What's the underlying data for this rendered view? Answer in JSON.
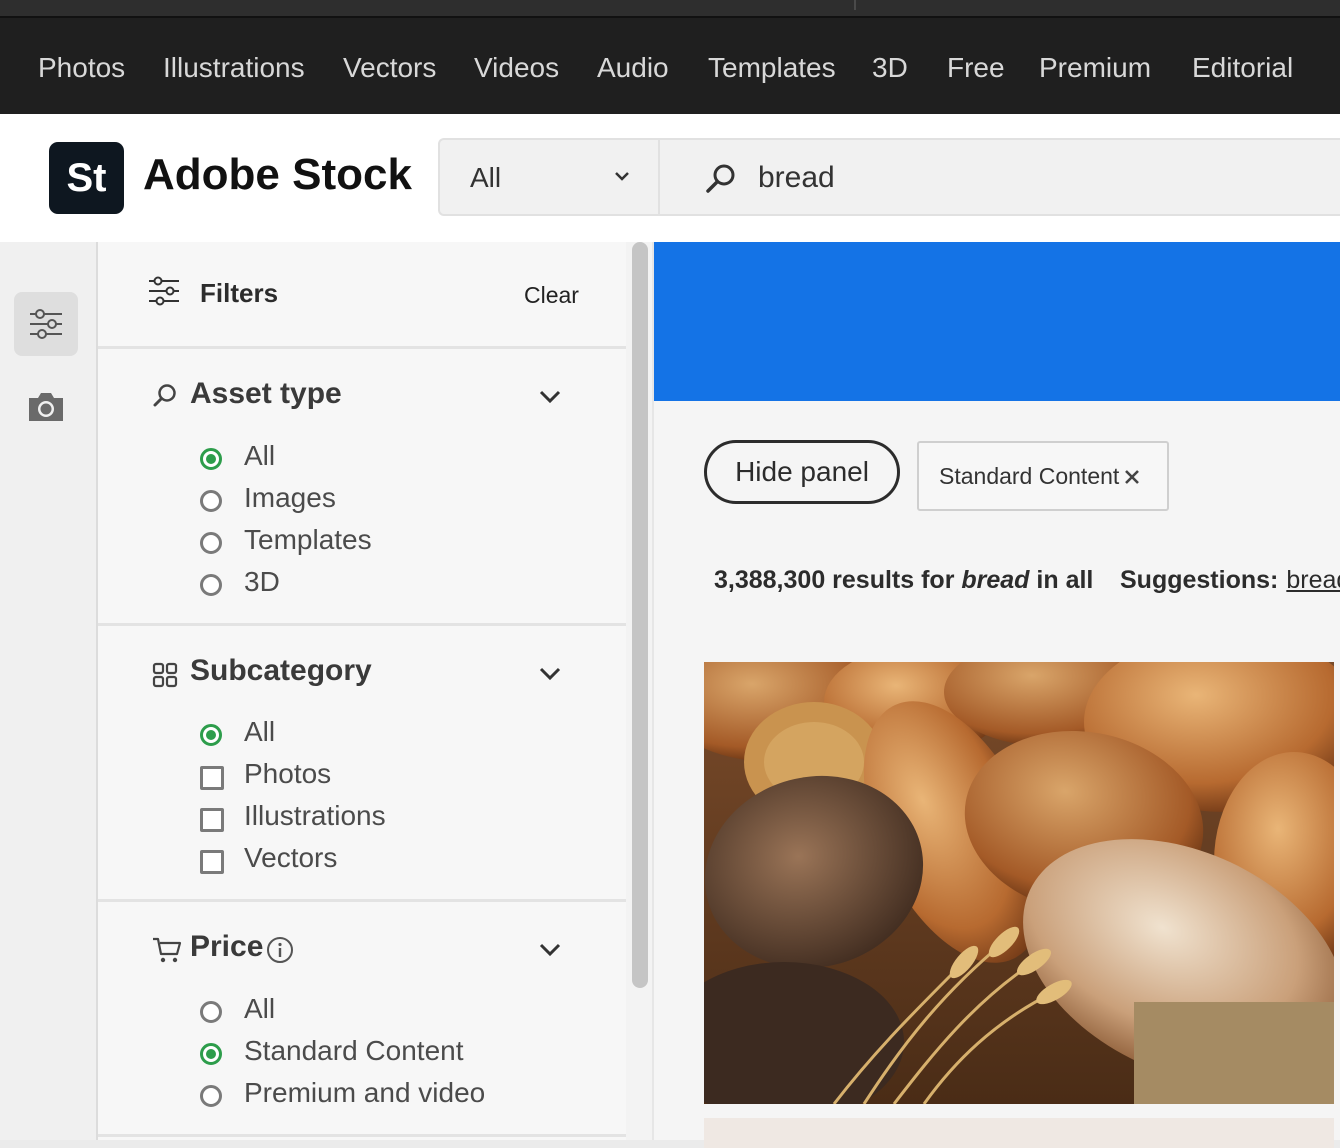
{
  "top_nav": {
    "items": [
      "Photos",
      "Illustrations",
      "Vectors",
      "Videos",
      "Audio",
      "Templates",
      "3D",
      "Free",
      "Premium",
      "Editorial"
    ]
  },
  "header": {
    "logo_text": "St",
    "brand": "Adobe Stock",
    "search_scope": "All",
    "search_query": "bread"
  },
  "left_rail": {
    "filter_icon": "sliders-icon",
    "camera_icon": "camera-icon"
  },
  "filters": {
    "title": "Filters",
    "clear_label": "Clear",
    "asset_type": {
      "title": "Asset type",
      "icon": "search-icon",
      "options": [
        {
          "label": "All",
          "selected": true
        },
        {
          "label": "Images",
          "selected": false
        },
        {
          "label": "Templates",
          "selected": false
        },
        {
          "label": "3D",
          "selected": false
        }
      ]
    },
    "subcategory": {
      "title": "Subcategory",
      "icon": "grid-icon",
      "options": [
        {
          "label": "All",
          "selected": true
        },
        {
          "label": "Photos",
          "selected": false
        },
        {
          "label": "Illustrations",
          "selected": false
        },
        {
          "label": "Vectors",
          "selected": false
        }
      ]
    },
    "price": {
      "title": "Price",
      "icon": "cart-icon",
      "options": [
        {
          "label": "All",
          "selected": false
        },
        {
          "label": "Standard Content",
          "selected": true
        },
        {
          "label": "Premium and video",
          "selected": false
        }
      ]
    }
  },
  "results": {
    "hide_panel_label": "Hide panel",
    "active_chip": "Standard Content",
    "count_text": "3,388,300 results for",
    "query": "bread",
    "scope_text": "in all",
    "suggestions_label": "Suggestions:",
    "suggestion_link": "bread"
  },
  "colors": {
    "accent_blue": "#1473e6",
    "selected_green": "#2d9d4b",
    "nav_bg": "#1f1f1f"
  }
}
